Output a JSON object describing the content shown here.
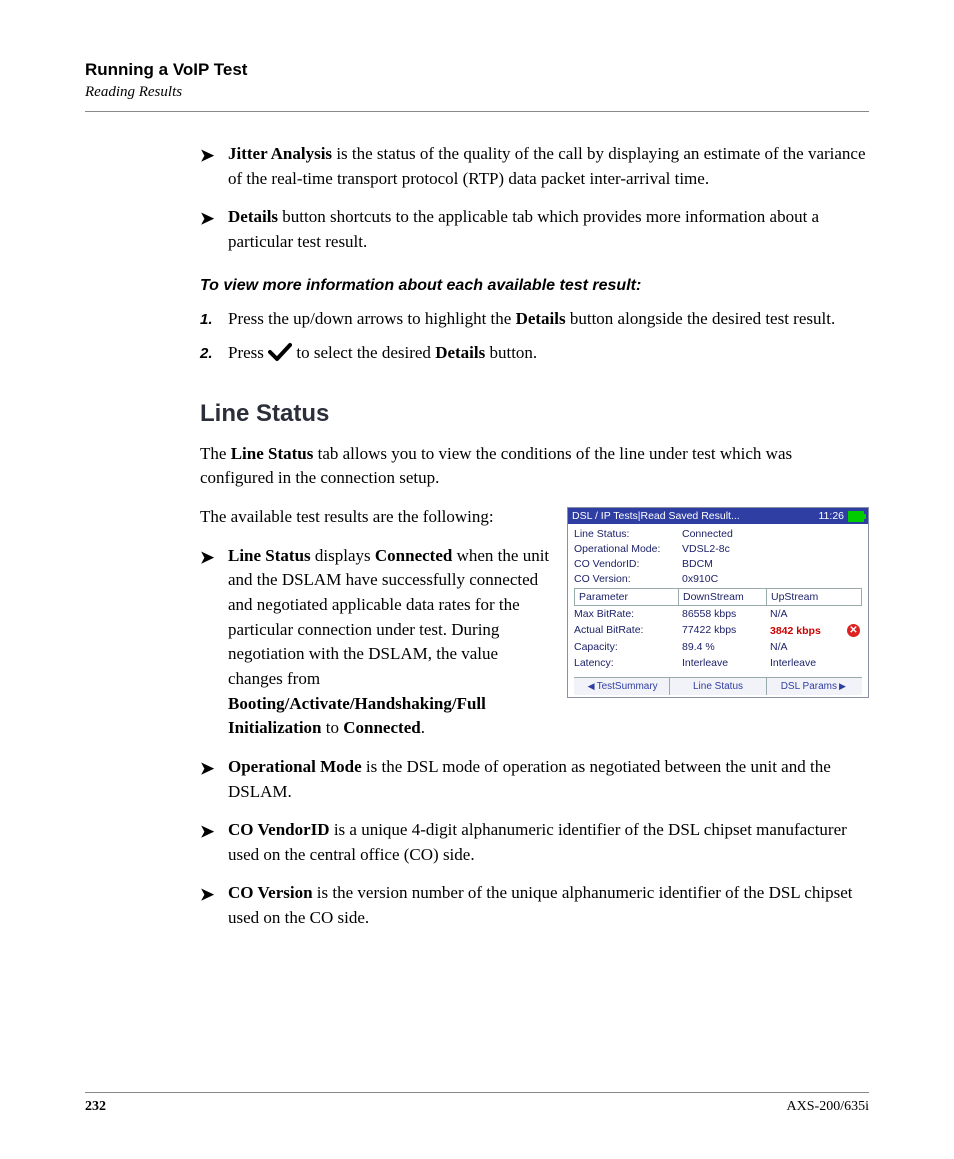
{
  "header": {
    "running_title": "Running a VoIP Test",
    "sub_title": "Reading Results"
  },
  "bullets_top": [
    {
      "bold": "Jitter Analysis",
      "rest": " is the status of the quality of the call by displaying an estimate of the variance of the real-time transport protocol (RTP) data packet inter-arrival time."
    },
    {
      "bold": "Details",
      "rest": " button shortcuts to the applicable tab which provides more information about a particular test result."
    }
  ],
  "instruction_head": "To view more information about each available test result:",
  "steps": {
    "s1_pre": "Press the up/down arrows to highlight the ",
    "s1_bold": "Details",
    "s1_post": " button alongside the desired test result.",
    "s2_pre": "Press ",
    "s2_mid": " to select the desired ",
    "s2_bold": "Details",
    "s2_post": " button."
  },
  "section_title": "Line Status",
  "para1_pre": "The ",
  "para1_bold": "Line Status",
  "para1_post": " tab allows you to view the conditions of the line under test which was configured in the connection setup.",
  "para2": "The available test results are the following:",
  "bullets_bottom": {
    "b1_bold": "Line Status",
    "b1_mid1": " displays ",
    "b1_bold2": "Connected",
    "b1_mid2": " when the unit and the DSLAM have successfully connected and negotiated applicable data rates for the particular connection under test. During negotiation with the DSLAM, the value changes from ",
    "b1_bold3": "Booting/Activate/Handshaking/Full Initialization",
    "b1_mid3": " to ",
    "b1_bold4": "Connected",
    "b1_end": ".",
    "b2_bold": "Operational Mode",
    "b2_rest": " is the DSL mode of operation as negotiated between the unit and the DSLAM.",
    "b3_bold": "CO VendorID",
    "b3_rest": " is a unique 4-digit alphanumeric identifier of the DSL chipset manufacturer used on the central office (CO) side.",
    "b4_bold": "CO Version",
    "b4_rest": " is the version number of the unique alphanumeric identifier of the DSL chipset used on the CO side."
  },
  "screenshot": {
    "title": "DSL / IP Tests|Read Saved Result...",
    "time": "11:26",
    "rows": [
      {
        "label": "Line Status:",
        "value": "Connected"
      },
      {
        "label": "Operational Mode:",
        "value": "VDSL2-8c"
      },
      {
        "label": "CO VendorID:",
        "value": "BDCM"
      },
      {
        "label": "CO Version:",
        "value": "0x910C"
      }
    ],
    "thead": {
      "p": "Parameter",
      "d": "DownStream",
      "u": "UpStream"
    },
    "trows": [
      {
        "p": "Max BitRate:",
        "d": "86558 kbps",
        "u": "N/A",
        "err": false
      },
      {
        "p": "Actual BitRate:",
        "d": "77422 kbps",
        "u": "3842 kbps",
        "err": true,
        "red": true
      },
      {
        "p": "Capacity:",
        "d": "89.4 %",
        "u": "N/A",
        "err": false
      },
      {
        "p": "Latency:",
        "d": "Interleave",
        "u": "Interleave",
        "err": false
      }
    ],
    "tabs": [
      "TestSummary",
      "Line Status",
      "DSL Params"
    ]
  },
  "footer": {
    "page": "232",
    "model": "AXS-200/635i"
  }
}
